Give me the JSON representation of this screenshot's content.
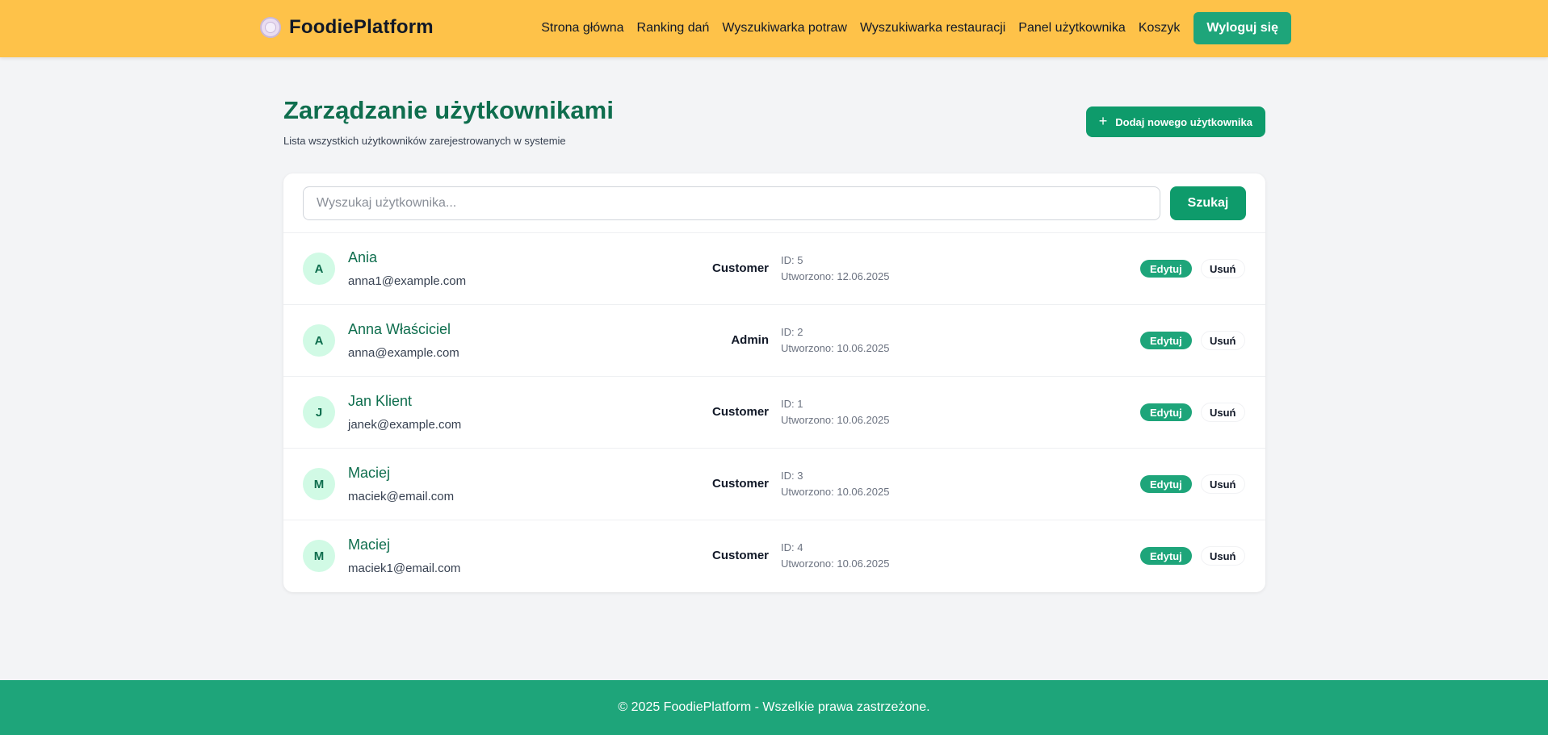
{
  "header": {
    "brand": "FoodiePlatform",
    "nav": [
      "Strona główna",
      "Ranking dań",
      "Wyszukiwarka potraw",
      "Wyszukiwarka restauracji",
      "Panel użytkownika",
      "Koszyk"
    ],
    "logout_label": "Wyloguj się",
    "bg_color": "#fec249"
  },
  "page": {
    "title": "Zarządzanie użytkownikami",
    "subtitle": "Lista wszystkich użytkowników zarejestrowanych w systemie",
    "add_button_label": "Dodaj nowego użytkownika",
    "add_button_icon": "plus-icon"
  },
  "search": {
    "placeholder": "Wyszukaj użytkownika...",
    "value": "",
    "button_label": "Szukaj"
  },
  "users": [
    {
      "initial": "A",
      "name": "Ania",
      "email": "anna1@example.com",
      "role": "Customer",
      "id": "ID: 5",
      "created": "Utworzono: 12.06.2025",
      "edit_label": "Edytuj",
      "delete_label": "Usuń"
    },
    {
      "initial": "A",
      "name": "Anna Właściciel",
      "email": "anna@example.com",
      "role": "Admin",
      "id": "ID: 2",
      "created": "Utworzono: 10.06.2025",
      "edit_label": "Edytuj",
      "delete_label": "Usuń"
    },
    {
      "initial": "J",
      "name": "Jan Klient",
      "email": "janek@example.com",
      "role": "Customer",
      "id": "ID: 1",
      "created": "Utworzono: 10.06.2025",
      "edit_label": "Edytuj",
      "delete_label": "Usuń"
    },
    {
      "initial": "M",
      "name": "Maciej",
      "email": "maciek@email.com",
      "role": "Customer",
      "id": "ID: 3",
      "created": "Utworzono: 10.06.2025",
      "edit_label": "Edytuj",
      "delete_label": "Usuń"
    },
    {
      "initial": "M",
      "name": "Maciej",
      "email": "maciek1@email.com",
      "role": "Customer",
      "id": "ID: 4",
      "created": "Utworzono: 10.06.2025",
      "edit_label": "Edytuj",
      "delete_label": "Usuń"
    }
  ],
  "footer": {
    "text": "© 2025 FoodiePlatform - Wszelkie prawa zastrzeżone.",
    "bg_color": "#1ea57a"
  },
  "colors": {
    "accent": "#0e9b6b",
    "title": "#0f6e4e"
  }
}
